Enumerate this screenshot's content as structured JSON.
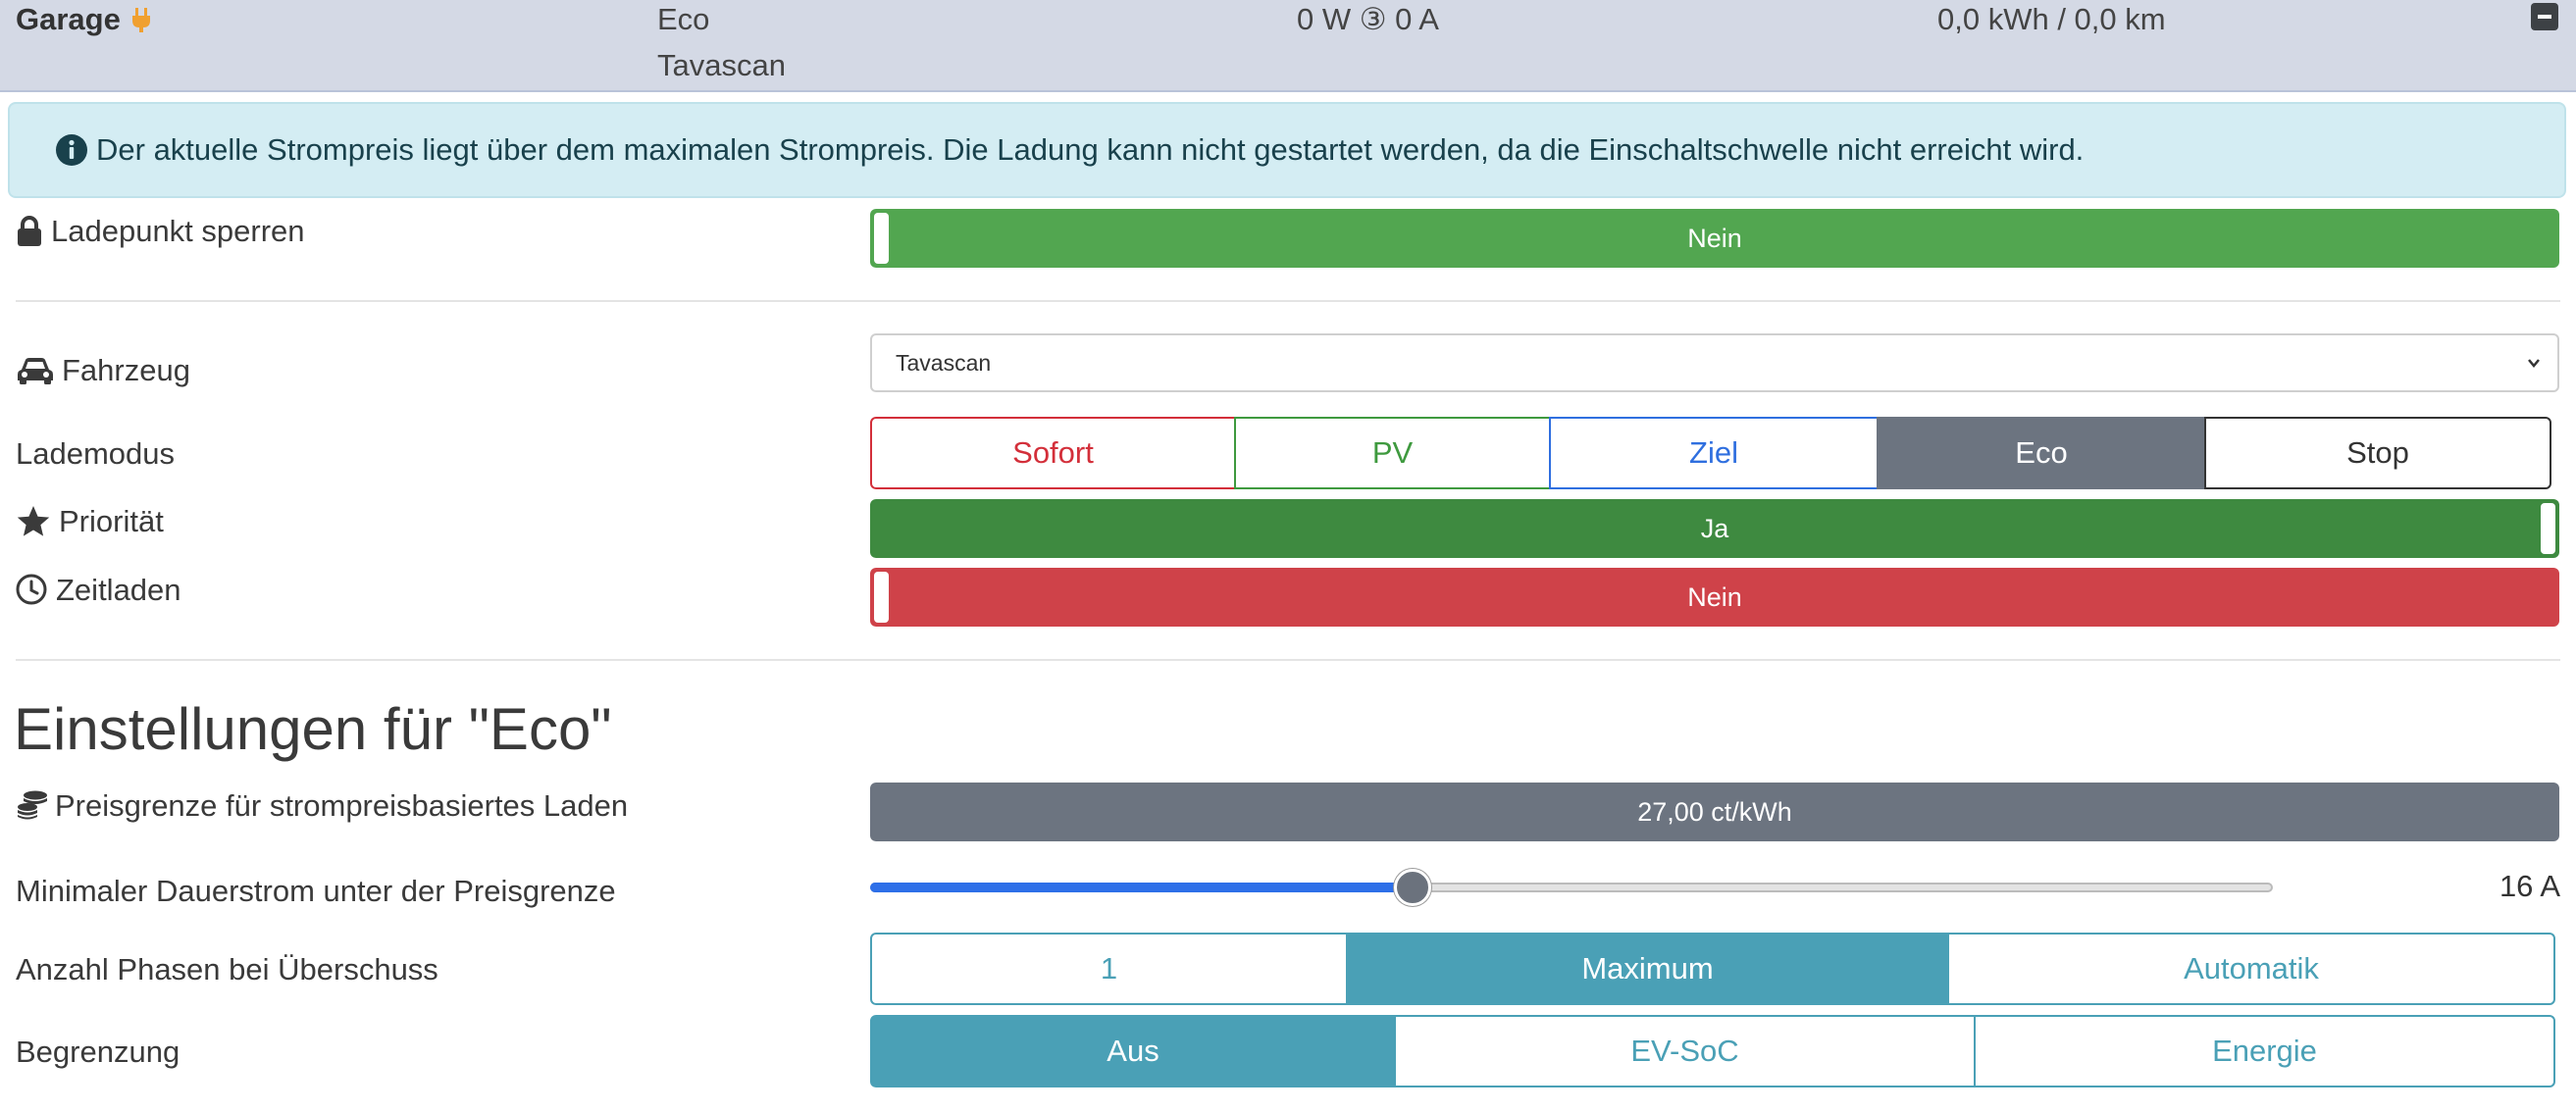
{
  "header": {
    "title": "Garage",
    "mode": "Eco",
    "vehicle": "Tavascan",
    "power": "0 W ③ 0 A",
    "energy": "0,0 kWh / 0,0 km",
    "plug_icon": "charging-plug-icon",
    "collapse_icon": "minus-square-icon"
  },
  "alert": {
    "icon": "info-circle-icon",
    "text": "Der aktuelle Strompreis liegt über dem maximalen Strompreis. Die Ladung kann nicht gestartet werden, da die Einschaltschwelle nicht erreicht wird."
  },
  "lock": {
    "label": "Ladepunkt sperren",
    "value": "Nein",
    "on": false,
    "color": "#52a650"
  },
  "vehicle": {
    "label": "Fahrzeug",
    "selected": "Tavascan"
  },
  "mode": {
    "label": "Lademodus",
    "options": [
      "Sofort",
      "PV",
      "Ziel",
      "Eco",
      "Stop"
    ],
    "selected": "Eco",
    "colors": [
      "#d32f3a",
      "#3f9a3f",
      "#2f6fdf",
      "#6c7480",
      "#333333"
    ]
  },
  "priority": {
    "label": "Priorität",
    "value": "Ja",
    "on": true,
    "color": "#3e8a40"
  },
  "scheduled": {
    "label": "Zeitladen",
    "value": "Nein",
    "on": false,
    "color": "#cf4249"
  },
  "settings": {
    "title": "Einstellungen für \"Eco\"",
    "price_limit": {
      "label": "Preisgrenze für strompreisbasiertes Laden",
      "value": "27,00 ct/kWh"
    },
    "min_current": {
      "label": "Minimaler Dauerstrom unter der Preisgrenze",
      "value": "16 A",
      "slider_fraction": 0.387
    },
    "phases": {
      "label": "Anzahl Phasen bei Überschuss",
      "options": [
        "1",
        "Maximum",
        "Automatik"
      ],
      "selected": "Maximum"
    },
    "limit": {
      "label": "Begrenzung",
      "options": [
        "Aus",
        "EV-SoC",
        "Energie"
      ],
      "selected": "Aus"
    },
    "accent": "#4aa0b6"
  }
}
